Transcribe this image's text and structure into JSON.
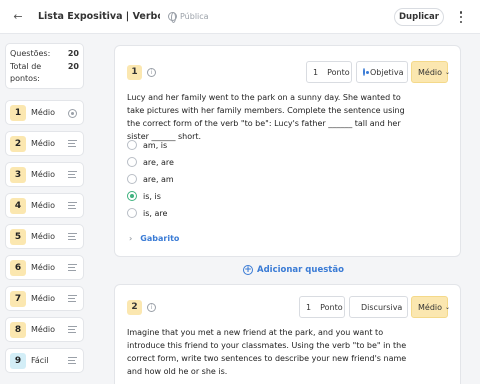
{
  "header": {
    "title": "Lista Expositiva | Verbos: In...",
    "visibility": "Pública",
    "duplicate_label": "Duplicar"
  },
  "stats": {
    "questions_label": "Questões:",
    "questions_value": "20",
    "points_label": "Total de pontos:",
    "points_value": "20"
  },
  "sidebar": {
    "items": [
      {
        "number": "1",
        "level": "Médio",
        "icon": "radio-icon",
        "color": "#fbe7b0"
      },
      {
        "number": "2",
        "level": "Médio",
        "icon": "lines-icon",
        "color": "#fbe7b0"
      },
      {
        "number": "3",
        "level": "Médio",
        "icon": "lines-icon",
        "color": "#fbe7b0"
      },
      {
        "number": "4",
        "level": "Médio",
        "icon": "lines-icon",
        "color": "#fbe7b0"
      },
      {
        "number": "5",
        "level": "Médio",
        "icon": "lines-icon",
        "color": "#fbe7b0"
      },
      {
        "number": "6",
        "level": "Médio",
        "icon": "lines-icon",
        "color": "#fbe7b0"
      },
      {
        "number": "7",
        "level": "Médio",
        "icon": "lines-icon",
        "color": "#fbe7b0"
      },
      {
        "number": "8",
        "level": "Médio",
        "icon": "lines-icon",
        "color": "#fbe7b0"
      },
      {
        "number": "9",
        "level": "Fácil",
        "icon": "lines-icon",
        "color": "#d3eef7"
      }
    ]
  },
  "questions": [
    {
      "number": "1",
      "points_value": "1",
      "points_label": "Ponto",
      "type": "Objetiva",
      "level": "Médio",
      "text": "Lucy and her family went to the park on a sunny day. She wanted to take pictures with her family members. Complete the sentence using the correct form of the verb \"to be\": Lucy's father ______ tall and her sister ______ short.",
      "options": [
        "am, is",
        "are, are",
        "are, am",
        "is, is",
        "is, are"
      ],
      "answer_label": "Gabarito"
    },
    {
      "number": "2",
      "points_value": "1",
      "points_label": "Ponto",
      "type": "Discursiva",
      "level": "Médio",
      "text": "Imagine that you met a new friend at the park, and you want to introduce this friend to your classmates. Using the verb \"to be\" in the correct form, write two sentences to describe your new friend's name and how old he or she is."
    }
  ],
  "add_question_label": "Adicionar questão",
  "colors": {
    "accent": "#3a7bd5",
    "medium": "#fbe7b0",
    "easy": "#d3eef7",
    "correct": "#3fb37f"
  }
}
